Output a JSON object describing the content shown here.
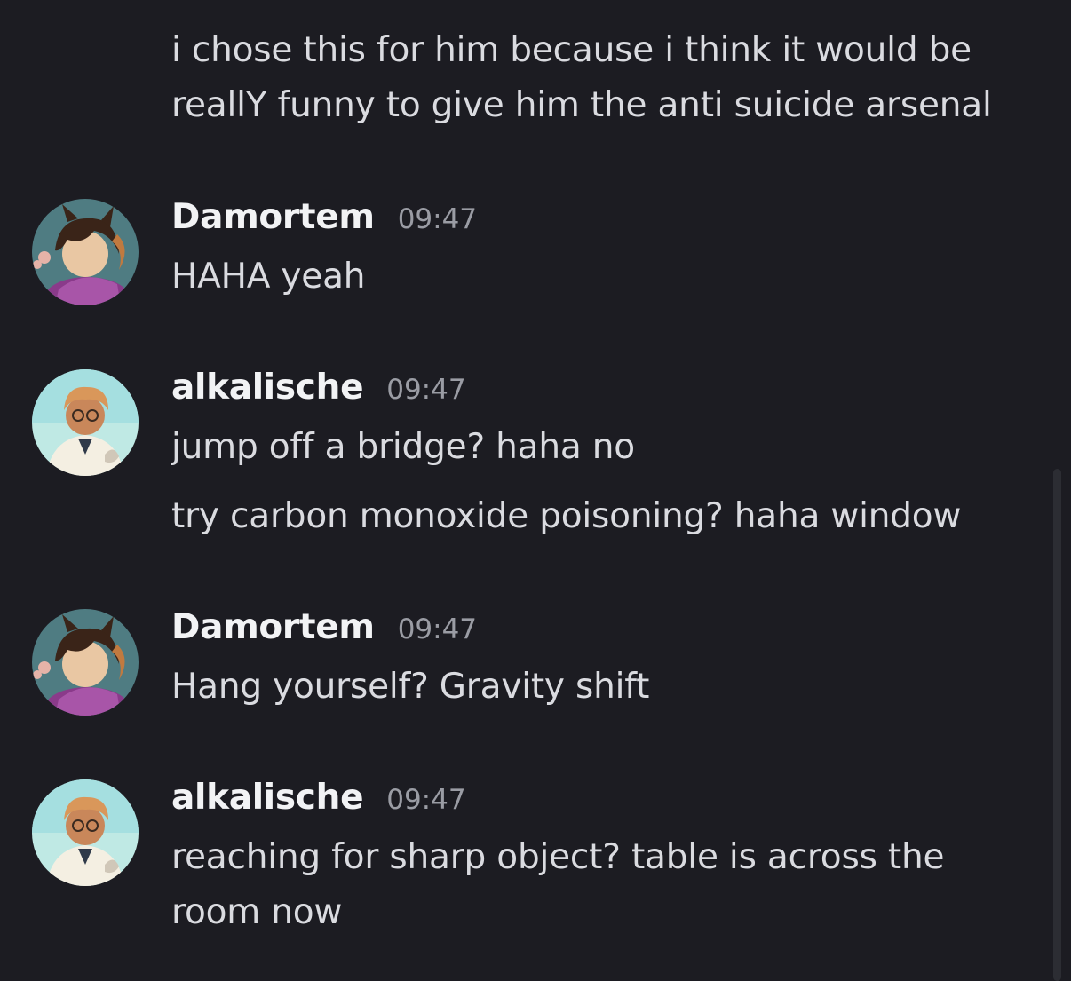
{
  "messages": {
    "top_continuation": {
      "lines": [
        "i chose this for him because i think it would be",
        "reallY funny to give him the anti suicide arsenal"
      ]
    },
    "groups": [
      {
        "username": "Damortem",
        "timestamp": "09:47",
        "lines": [
          "HAHA yeah"
        ]
      },
      {
        "username": "alkalische",
        "timestamp": "09:47",
        "lines": [
          "jump off a bridge? haha no",
          "try carbon monoxide poisoning? haha window"
        ]
      },
      {
        "username": "Damortem",
        "timestamp": "09:47",
        "lines": [
          "Hang yourself? Gravity shift"
        ]
      },
      {
        "username": "alkalische",
        "timestamp": "09:47",
        "lines": [
          "reaching for sharp object? table is across the",
          "room now"
        ]
      }
    ]
  },
  "colors": {
    "background": "#1c1c22",
    "username": "#f2f3f5",
    "timestamp": "#9a9ca4",
    "message_text": "#dadbe0"
  },
  "icons": {
    "damortem_avatar": "avatar-damortem-icon",
    "alkalische_avatar": "avatar-alkalische-icon"
  }
}
